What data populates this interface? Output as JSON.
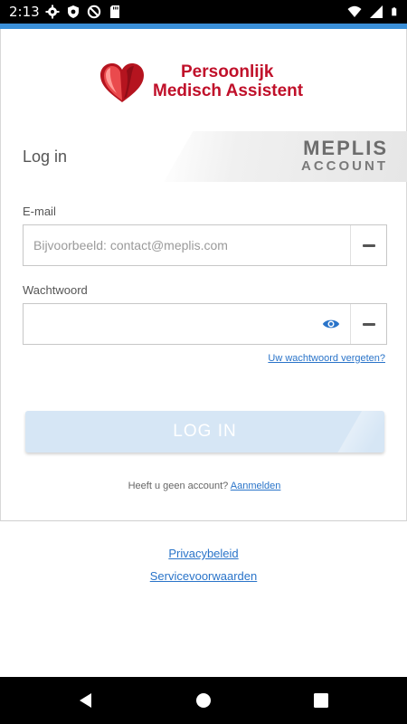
{
  "status_bar": {
    "time": "2:13",
    "left_icons": [
      "gear-icon",
      "shield-icon",
      "do-not-disturb-icon",
      "sd-card-icon"
    ],
    "right_icons": [
      "wifi-icon",
      "cell-signal-icon",
      "battery-icon"
    ]
  },
  "logo": {
    "line1": "Persoonlijk",
    "line2": "Medisch Assistent",
    "color": "#c0102a"
  },
  "header": {
    "title": "Log in",
    "brand_line1": "MEPLIS",
    "brand_line2": "ACCOUNT"
  },
  "form": {
    "email_label": "E-mail",
    "email_placeholder": "Bijvoorbeeld: contact@meplis.com",
    "password_label": "Wachtwoord",
    "password_value": "",
    "forgot_password": "Uw wachtwoord vergeten?",
    "login_button": "LOG IN"
  },
  "signup": {
    "prompt": "Heeft u geen account?",
    "link": "Aanmelden"
  },
  "footer": {
    "privacy": "Privacybeleid",
    "terms": "Servicevoorwaarden"
  },
  "colors": {
    "accent": "#3a8fd8",
    "link": "#2a74c9",
    "button_disabled": "#d6e6f5"
  },
  "nav": [
    "back-icon",
    "home-icon",
    "recents-icon"
  ]
}
